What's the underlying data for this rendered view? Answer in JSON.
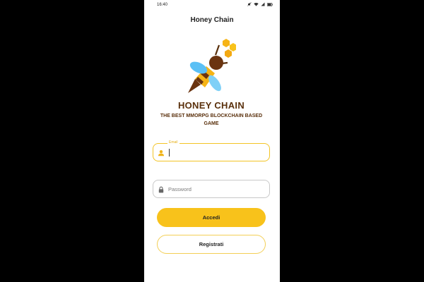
{
  "status": {
    "time": "16:40",
    "icons": [
      "mute-icon",
      "wifi-icon",
      "signal-icon",
      "battery-icon"
    ]
  },
  "app": {
    "title": "Honey Chain"
  },
  "logo": {
    "icon": "bee-logo"
  },
  "brand": {
    "name": "HONEY CHAIN",
    "tagline": "THE BEST MMORPG BLOCKCHAIN BASED GAME"
  },
  "form": {
    "email": {
      "label": "Email",
      "value": "",
      "icon": "person-icon"
    },
    "password": {
      "placeholder": "Password",
      "icon": "lock-icon"
    }
  },
  "buttons": {
    "login": "Accedi",
    "register": "Registrati"
  },
  "colors": {
    "accent": "#f8c21b",
    "brand_text": "#5a300c",
    "wing": "#5bc0f5",
    "body": "#f6b416",
    "dark": "#6b3410"
  }
}
